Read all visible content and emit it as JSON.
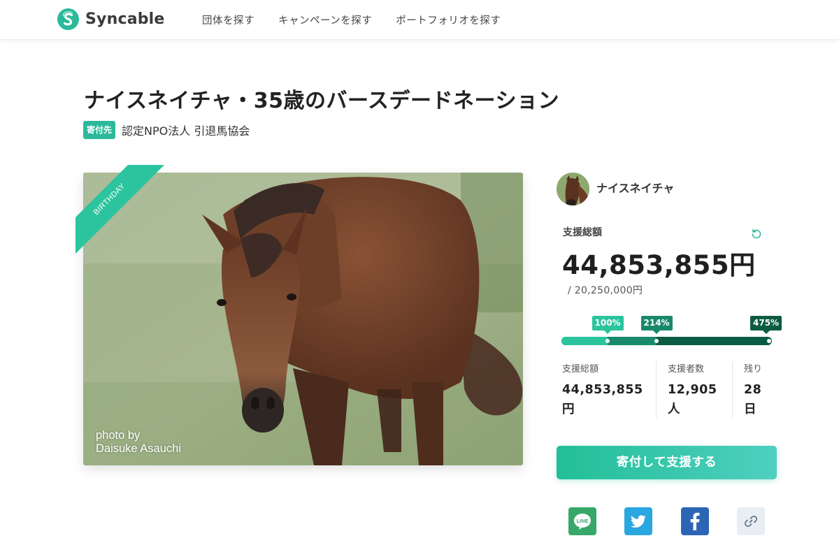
{
  "header": {
    "brand": "Syncable",
    "nav": [
      "団体を探す",
      "キャンペーンを探す",
      "ポートフォリオを探す"
    ]
  },
  "campaign": {
    "title": "ナイスネイチャ・35歳のバースデードネーション",
    "org_badge": "寄付先",
    "org_name": "認定NPO法人 引退馬協会",
    "ribbon": "BIRTHDAY",
    "photo_credit_line1": "photo by",
    "photo_credit_line2": "Daisuke Asauchi"
  },
  "sidebar": {
    "owner_name": "ナイスネイチャ",
    "total_label": "支援総額",
    "total_amount": "44,853,855円",
    "goal": "/ 20,250,000円",
    "progress_percent": 475,
    "milestones": [
      {
        "label": "100%",
        "percent": 100
      },
      {
        "label": "214%",
        "percent": 214
      },
      {
        "label": "475%",
        "percent": 475
      }
    ],
    "stats": [
      {
        "label": "支援総額",
        "value_line1": "44,853,855",
        "value_line2": "円"
      },
      {
        "label": "支援者数",
        "value_line1": "12,905",
        "value_line2": "人"
      },
      {
        "label": "残り",
        "value_line1": "28",
        "value_line2": "日"
      }
    ],
    "donate_button": "寄付して支援する",
    "share": [
      {
        "name": "line",
        "icon": "line-icon",
        "color": "#37a86a",
        "text": "LINE"
      },
      {
        "name": "twitter",
        "icon": "twitter-icon",
        "color": "#2aa6e0"
      },
      {
        "name": "facebook",
        "icon": "facebook-icon",
        "color": "#2d65b6"
      },
      {
        "name": "link",
        "icon": "link-icon",
        "color": "#e8eef4"
      }
    ]
  },
  "colors": {
    "brand": "#2bb99a",
    "progress_1": "#2bc49e",
    "progress_2": "#18896b",
    "progress_3": "#0c5c43"
  }
}
